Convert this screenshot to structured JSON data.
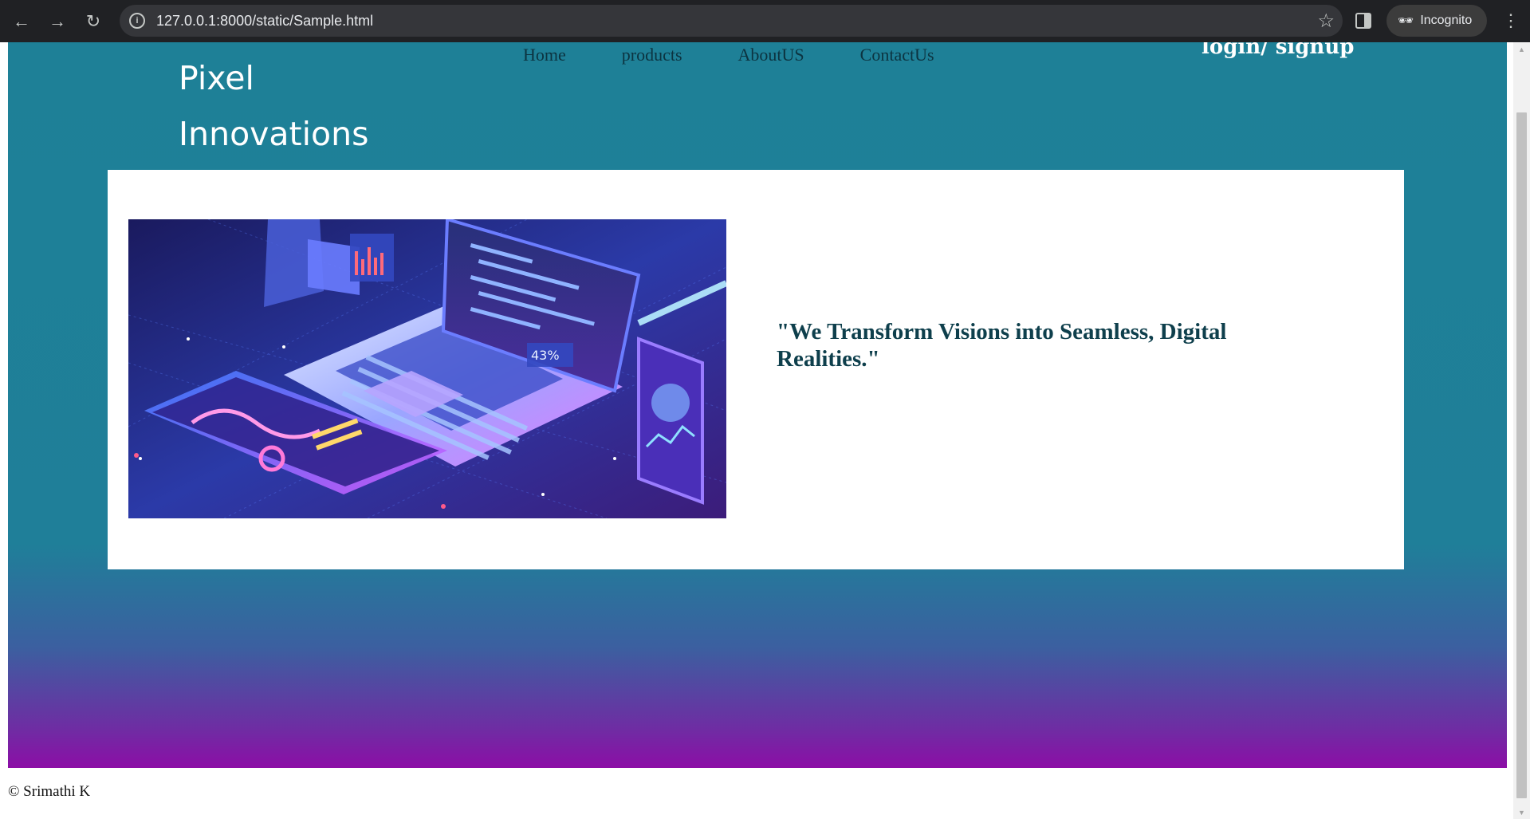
{
  "browser": {
    "url": "127.0.0.1:8000/static/Sample.html",
    "profile_label": "Incognito",
    "icons": {
      "back": "arrow-left-icon",
      "forward": "arrow-right-icon",
      "reload": "reload-icon",
      "site_info": "info-icon",
      "bookmark": "star-icon",
      "side_panel": "side-panel-icon",
      "incognito": "incognito-icon",
      "menu": "kebab-menu-icon"
    }
  },
  "header": {
    "logo_line1": "Pixel",
    "logo_line2": "Innovations",
    "nav": [
      {
        "label": "Home"
      },
      {
        "label": "products"
      },
      {
        "label": "AboutUS"
      },
      {
        "label": "ContactUs"
      }
    ],
    "auth_label": "login/ signup"
  },
  "hero": {
    "quote": "\"We Transform Visions into Seamless, Digital Realities.\"",
    "image_name": "isometric-laptop-dashboard-illustration"
  },
  "footer": {
    "copyright": "© Srimathi K"
  },
  "colors": {
    "header_teal": "#1e8097",
    "gradient_purple": "#8c0ea6",
    "quote_text": "#0e3f4c",
    "nav_text": "#0c3340"
  }
}
